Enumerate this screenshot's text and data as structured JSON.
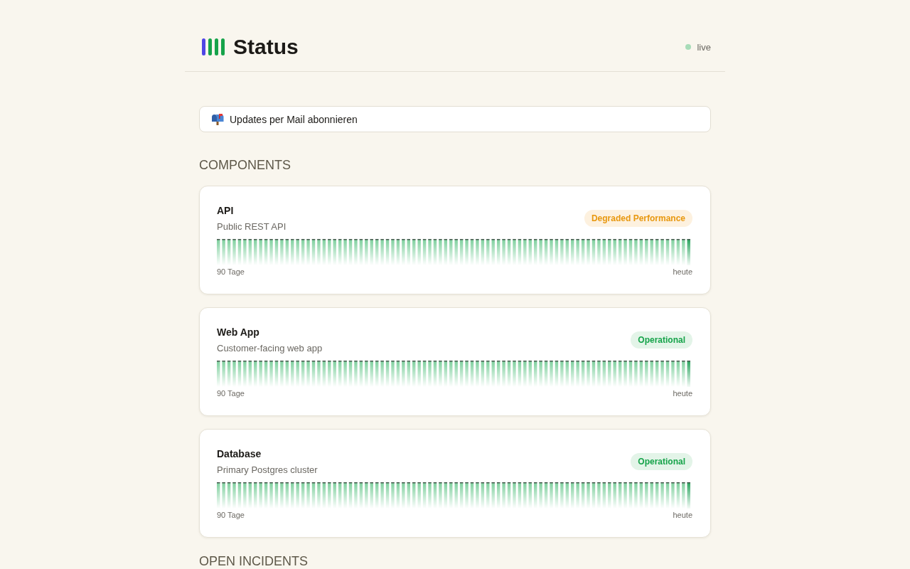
{
  "header": {
    "title": "Status",
    "live_label": "live"
  },
  "subscribe": {
    "label": "Updates per Mail abonnieren"
  },
  "components_heading": "COMPONENTS",
  "components": [
    {
      "name": "API",
      "description": "Public REST API",
      "status": {
        "label": "Degraded Performance",
        "kind": "degraded"
      },
      "history_start": "90 Tage",
      "history_end": "heute"
    },
    {
      "name": "Web App",
      "description": "Customer-facing web app",
      "status": {
        "label": "Operational",
        "kind": "operational"
      },
      "history_start": "90 Tage",
      "history_end": "heute"
    },
    {
      "name": "Database",
      "description": "Primary Postgres cluster",
      "status": {
        "label": "Operational",
        "kind": "operational"
      },
      "history_start": "90 Tage",
      "history_end": "heute"
    }
  ],
  "incidents_heading": "OPEN INCIDENTS"
}
